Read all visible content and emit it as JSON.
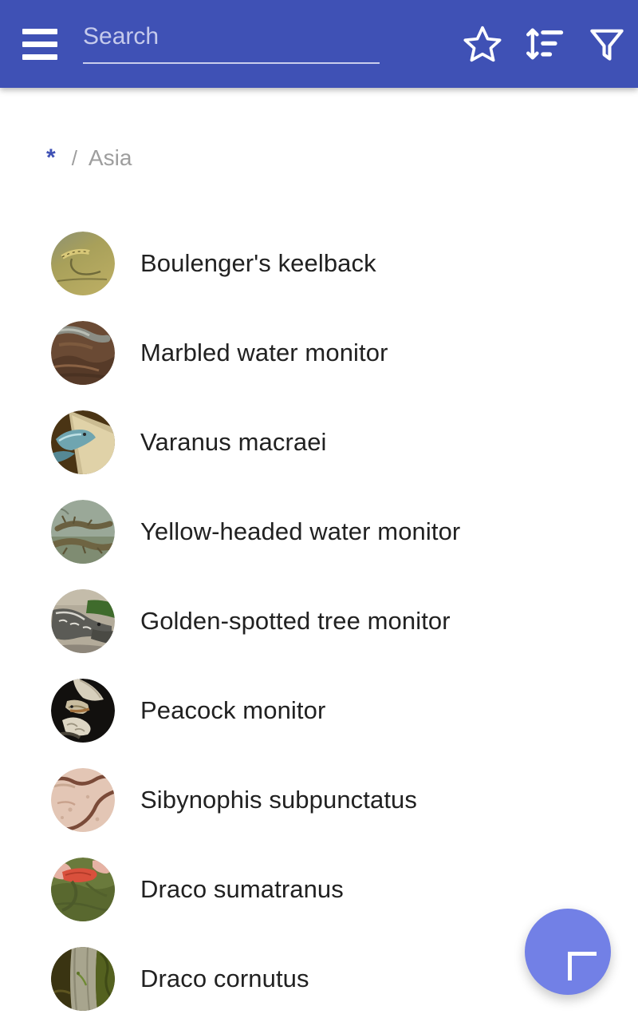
{
  "theme": {
    "appbar_color": "#3f51b5",
    "fab_color": "#7280e6",
    "accent_color": "#3f51b5",
    "text_color": "#212121",
    "muted_text_color": "#9e9e9e",
    "background": "#ffffff"
  },
  "appbar": {
    "menu_icon": "hamburger-menu-icon",
    "search": {
      "placeholder": "Search",
      "value": ""
    },
    "actions": [
      {
        "name": "favorites-button",
        "icon": "star-outline-icon",
        "label": "Favorites"
      },
      {
        "name": "sort-button",
        "icon": "sort-icon",
        "label": "Sort"
      },
      {
        "name": "filter-button",
        "icon": "filter-funnel-icon",
        "label": "Filter"
      }
    ]
  },
  "breadcrumb": {
    "root": "*",
    "separator": "/",
    "current": "Asia"
  },
  "list": {
    "items": [
      {
        "label": "Boulenger's keelback",
        "thumb": "snake-olive-thumb"
      },
      {
        "label": "Marbled water monitor",
        "thumb": "monitor-brown-thumb"
      },
      {
        "label": "Varanus macraei",
        "thumb": "monitor-blue-thumb"
      },
      {
        "label": "Yellow-headed water monitor",
        "thumb": "monitor-green-thumb"
      },
      {
        "label": "Golden-spotted tree monitor",
        "thumb": "monitor-grey-thumb"
      },
      {
        "label": "Peacock monitor",
        "thumb": "monitor-dark-thumb"
      },
      {
        "label": "Sibynophis subpunctatus",
        "thumb": "snake-pink-thumb"
      },
      {
        "label": "Draco sumatranus",
        "thumb": "draco-red-thumb"
      },
      {
        "label": "Draco cornutus",
        "thumb": "draco-bark-thumb"
      }
    ]
  },
  "fab": {
    "label": "+",
    "icon": "plus-icon",
    "name": "add-button"
  }
}
